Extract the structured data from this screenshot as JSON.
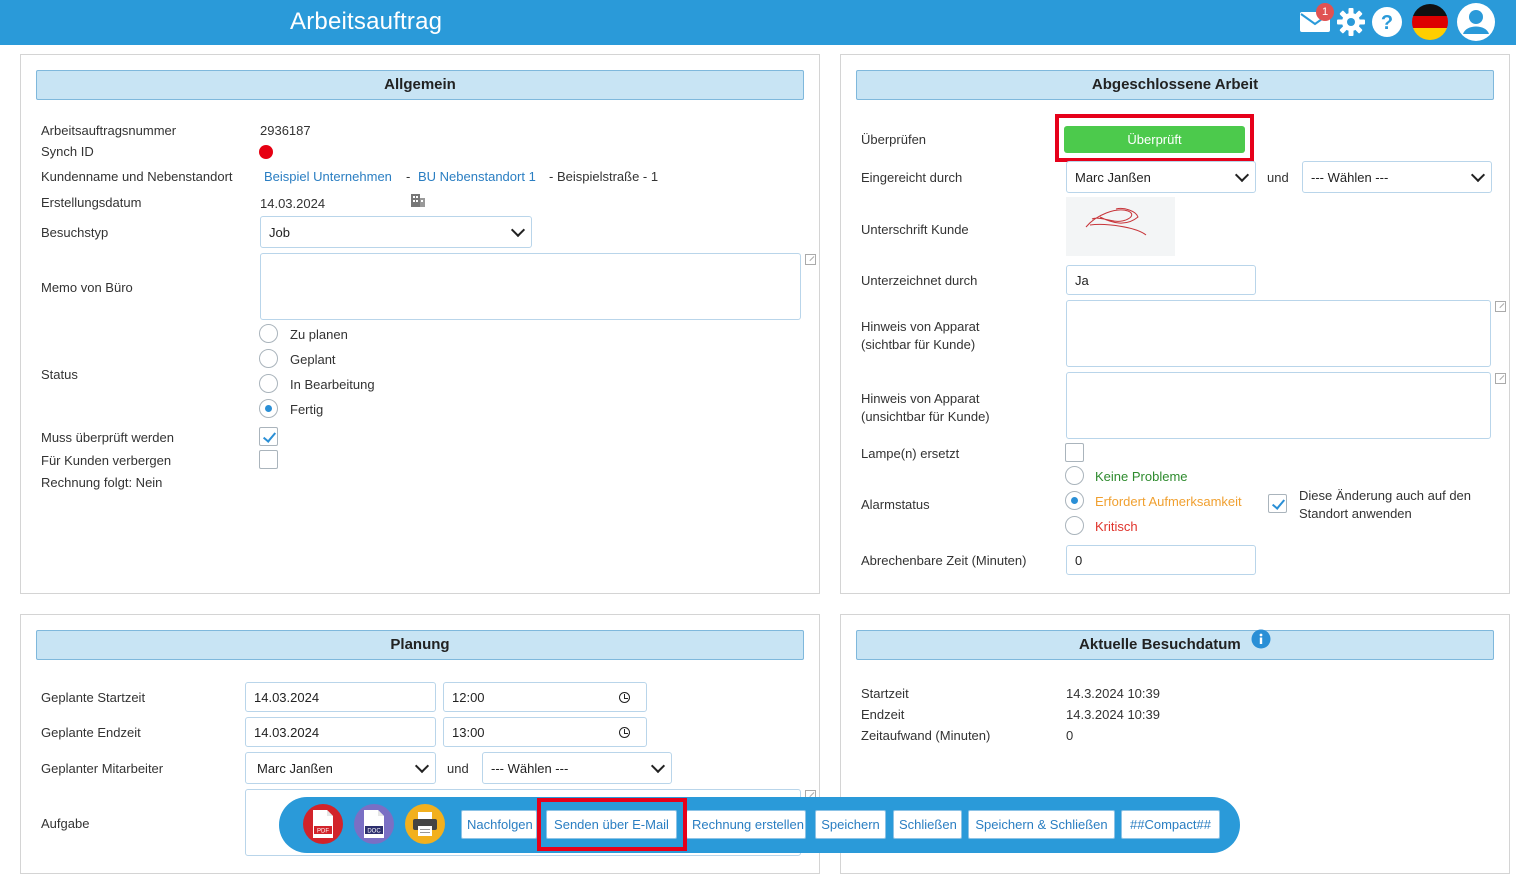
{
  "header": {
    "title": "Arbeitsauftrag",
    "mail_badge": "1",
    "icons": [
      "mail-icon",
      "gear-icon",
      "help-icon",
      "german-flag-icon",
      "user-avatar-icon"
    ]
  },
  "allgemein": {
    "title": "Allgemein",
    "order_number_label": "Arbeitsauftragsnummer",
    "order_number": "2936187",
    "synch_id_label": "Synch ID",
    "customer_label": "Kundenname und Nebenstandort",
    "customer_link": "Beispiel Unternehmen",
    "separator": "-",
    "branch_link": "BU Nebenstandort 1",
    "address": "- Beispielstraße - 1",
    "created_label": "Erstellungsdatum",
    "created_date": "14.03.2024",
    "visit_type_label": "Besuchstyp",
    "visit_type_value": "Job",
    "memo_label": "Memo von Büro",
    "memo_value": "",
    "status_label": "Status",
    "status_options": [
      "Zu planen",
      "Geplant",
      "In Bearbeitung",
      "Fertig"
    ],
    "status_selected": "Fertig",
    "must_review_label": "Muss überprüft werden",
    "must_review_checked": true,
    "hide_customer_label": "Für Kunden verbergen",
    "hide_customer_checked": false,
    "invoice_follows": "Rechnung folgt: Nein"
  },
  "abgeschlossen": {
    "title": "Abgeschlossene Arbeit",
    "review_label": "Überprüfen",
    "review_button": "Überprüft",
    "submitted_by_label": "Eingereicht durch",
    "submitted_by_value": "Marc Janßen",
    "and_label": "und",
    "choose_value": "--- Wählen ---",
    "signature_label": "Unterschrift Kunde",
    "signed_by_label": "Unterzeichnet durch",
    "signed_by_value": "Ja",
    "note_visible_label_1": "Hinweis von Apparat",
    "note_visible_label_2": "(sichtbar für Kunde)",
    "note_hidden_label_1": "Hinweis von Apparat",
    "note_hidden_label_2": "(unsichtbar für Kunde)",
    "lamps_label": "Lampe(n) ersetzt",
    "alarm_label": "Alarmstatus",
    "alarm_options": [
      "Keine Probleme",
      "Erfordert Aufmerksamkeit",
      "Kritisch"
    ],
    "alarm_selected": "Erfordert Aufmerksamkeit",
    "apply_location_label_1": "Diese Änderung auch auf den",
    "apply_location_label_2": "Standort anwenden",
    "billable_label": "Abrechenbare Zeit (Minuten)",
    "billable_value": "0"
  },
  "planung": {
    "title": "Planung",
    "start_label": "Geplante Startzeit",
    "start_date": "14.03.2024",
    "start_time": "12:00",
    "end_label": "Geplante Endzeit",
    "end_date": "14.03.2024",
    "end_time": "13:00",
    "employee_label": "Geplanter Mitarbeiter",
    "employee_value": "Marc Janßen",
    "and_label": "und",
    "choose_value": "--- Wählen ---",
    "task_label": "Aufgabe"
  },
  "besuch": {
    "title": "Aktuelle Besuchdatum",
    "start_label": "Startzeit",
    "start_value": "14.3.2024 10:39",
    "end_label": "Endzeit",
    "end_value": "14.3.2024 10:39",
    "duration_label": "Zeitaufwand (Minuten)",
    "duration_value": "0"
  },
  "toolbar": {
    "pdf_label": "PDF",
    "doc_label": "DOC",
    "buttons": [
      "Nachfolgen",
      "Senden über E-Mail",
      "Rechnung erstellen",
      "Speichern",
      "Schließen",
      "Speichern & Schließen",
      "##Compact##"
    ]
  },
  "colors": {
    "header": "#2a9ad9",
    "accent_green": "#4cca4c",
    "highlight_red": "#e6001a",
    "link": "#2a7ec2"
  }
}
